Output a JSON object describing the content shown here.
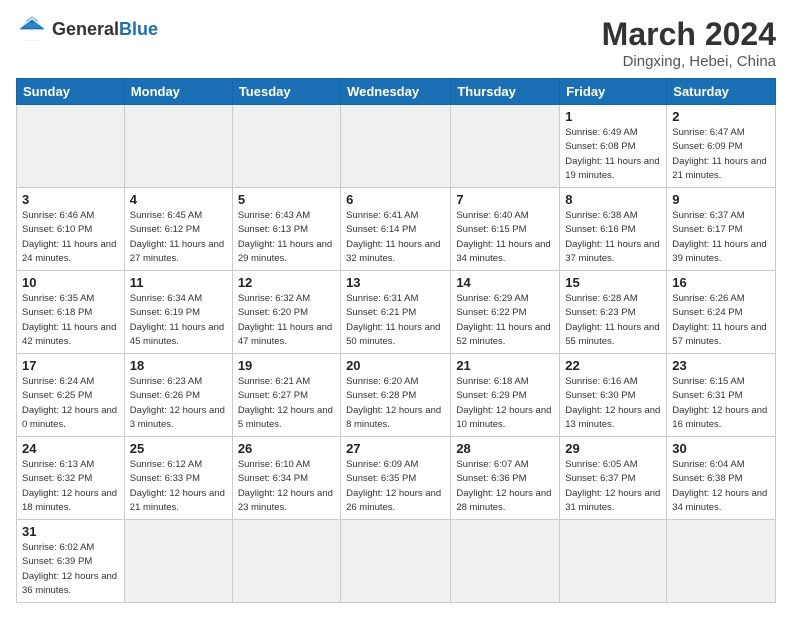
{
  "header": {
    "logo_general": "General",
    "logo_blue": "Blue",
    "month_title": "March 2024",
    "location": "Dingxing, Hebei, China"
  },
  "days_of_week": [
    "Sunday",
    "Monday",
    "Tuesday",
    "Wednesday",
    "Thursday",
    "Friday",
    "Saturday"
  ],
  "weeks": [
    [
      {
        "day": "",
        "info": ""
      },
      {
        "day": "",
        "info": ""
      },
      {
        "day": "",
        "info": ""
      },
      {
        "day": "",
        "info": ""
      },
      {
        "day": "",
        "info": ""
      },
      {
        "day": "1",
        "info": "Sunrise: 6:49 AM\nSunset: 6:08 PM\nDaylight: 11 hours and 19 minutes."
      },
      {
        "day": "2",
        "info": "Sunrise: 6:47 AM\nSunset: 6:09 PM\nDaylight: 11 hours and 21 minutes."
      }
    ],
    [
      {
        "day": "3",
        "info": "Sunrise: 6:46 AM\nSunset: 6:10 PM\nDaylight: 11 hours and 24 minutes."
      },
      {
        "day": "4",
        "info": "Sunrise: 6:45 AM\nSunset: 6:12 PM\nDaylight: 11 hours and 27 minutes."
      },
      {
        "day": "5",
        "info": "Sunrise: 6:43 AM\nSunset: 6:13 PM\nDaylight: 11 hours and 29 minutes."
      },
      {
        "day": "6",
        "info": "Sunrise: 6:41 AM\nSunset: 6:14 PM\nDaylight: 11 hours and 32 minutes."
      },
      {
        "day": "7",
        "info": "Sunrise: 6:40 AM\nSunset: 6:15 PM\nDaylight: 11 hours and 34 minutes."
      },
      {
        "day": "8",
        "info": "Sunrise: 6:38 AM\nSunset: 6:16 PM\nDaylight: 11 hours and 37 minutes."
      },
      {
        "day": "9",
        "info": "Sunrise: 6:37 AM\nSunset: 6:17 PM\nDaylight: 11 hours and 39 minutes."
      }
    ],
    [
      {
        "day": "10",
        "info": "Sunrise: 6:35 AM\nSunset: 6:18 PM\nDaylight: 11 hours and 42 minutes."
      },
      {
        "day": "11",
        "info": "Sunrise: 6:34 AM\nSunset: 6:19 PM\nDaylight: 11 hours and 45 minutes."
      },
      {
        "day": "12",
        "info": "Sunrise: 6:32 AM\nSunset: 6:20 PM\nDaylight: 11 hours and 47 minutes."
      },
      {
        "day": "13",
        "info": "Sunrise: 6:31 AM\nSunset: 6:21 PM\nDaylight: 11 hours and 50 minutes."
      },
      {
        "day": "14",
        "info": "Sunrise: 6:29 AM\nSunset: 6:22 PM\nDaylight: 11 hours and 52 minutes."
      },
      {
        "day": "15",
        "info": "Sunrise: 6:28 AM\nSunset: 6:23 PM\nDaylight: 11 hours and 55 minutes."
      },
      {
        "day": "16",
        "info": "Sunrise: 6:26 AM\nSunset: 6:24 PM\nDaylight: 11 hours and 57 minutes."
      }
    ],
    [
      {
        "day": "17",
        "info": "Sunrise: 6:24 AM\nSunset: 6:25 PM\nDaylight: 12 hours and 0 minutes."
      },
      {
        "day": "18",
        "info": "Sunrise: 6:23 AM\nSunset: 6:26 PM\nDaylight: 12 hours and 3 minutes."
      },
      {
        "day": "19",
        "info": "Sunrise: 6:21 AM\nSunset: 6:27 PM\nDaylight: 12 hours and 5 minutes."
      },
      {
        "day": "20",
        "info": "Sunrise: 6:20 AM\nSunset: 6:28 PM\nDaylight: 12 hours and 8 minutes."
      },
      {
        "day": "21",
        "info": "Sunrise: 6:18 AM\nSunset: 6:29 PM\nDaylight: 12 hours and 10 minutes."
      },
      {
        "day": "22",
        "info": "Sunrise: 6:16 AM\nSunset: 6:30 PM\nDaylight: 12 hours and 13 minutes."
      },
      {
        "day": "23",
        "info": "Sunrise: 6:15 AM\nSunset: 6:31 PM\nDaylight: 12 hours and 16 minutes."
      }
    ],
    [
      {
        "day": "24",
        "info": "Sunrise: 6:13 AM\nSunset: 6:32 PM\nDaylight: 12 hours and 18 minutes."
      },
      {
        "day": "25",
        "info": "Sunrise: 6:12 AM\nSunset: 6:33 PM\nDaylight: 12 hours and 21 minutes."
      },
      {
        "day": "26",
        "info": "Sunrise: 6:10 AM\nSunset: 6:34 PM\nDaylight: 12 hours and 23 minutes."
      },
      {
        "day": "27",
        "info": "Sunrise: 6:09 AM\nSunset: 6:35 PM\nDaylight: 12 hours and 26 minutes."
      },
      {
        "day": "28",
        "info": "Sunrise: 6:07 AM\nSunset: 6:36 PM\nDaylight: 12 hours and 28 minutes."
      },
      {
        "day": "29",
        "info": "Sunrise: 6:05 AM\nSunset: 6:37 PM\nDaylight: 12 hours and 31 minutes."
      },
      {
        "day": "30",
        "info": "Sunrise: 6:04 AM\nSunset: 6:38 PM\nDaylight: 12 hours and 34 minutes."
      }
    ],
    [
      {
        "day": "31",
        "info": "Sunrise: 6:02 AM\nSunset: 6:39 PM\nDaylight: 12 hours and 36 minutes."
      },
      {
        "day": "",
        "info": ""
      },
      {
        "day": "",
        "info": ""
      },
      {
        "day": "",
        "info": ""
      },
      {
        "day": "",
        "info": ""
      },
      {
        "day": "",
        "info": ""
      },
      {
        "day": "",
        "info": ""
      }
    ]
  ]
}
